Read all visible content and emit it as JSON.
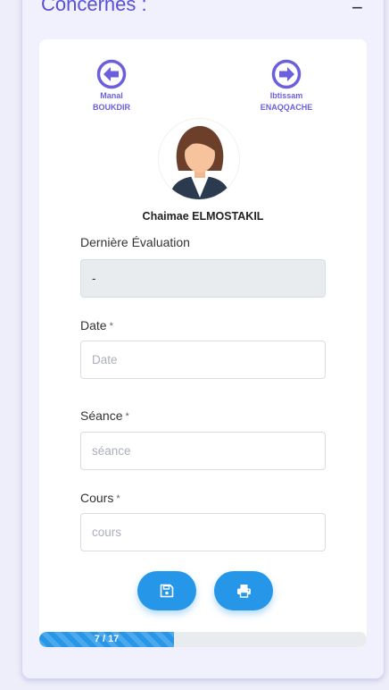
{
  "section": {
    "title": "Concernés :",
    "collapse_symbol": "−"
  },
  "navigation": {
    "previous": {
      "first_name": "Manal",
      "last_name": "BOUKDIR",
      "icon": "arrow-left-circle-icon"
    },
    "next": {
      "first_name": "Ibtissam",
      "last_name": "ENAQQACHE",
      "icon": "arrow-right-circle-icon"
    }
  },
  "student": {
    "name": "Chaimae ELMOSTAKIL",
    "avatar_icon": "female-avatar-icon"
  },
  "form": {
    "last_evaluation": {
      "label": "Dernière Évaluation",
      "value": "-"
    },
    "date": {
      "label": "Date",
      "required_mark": "*",
      "placeholder": "Date",
      "value": ""
    },
    "session": {
      "label": "Séance",
      "required_mark": "*",
      "placeholder": "séance",
      "value": ""
    },
    "course": {
      "label": "Cours",
      "required_mark": "*",
      "placeholder": "cours",
      "value": ""
    }
  },
  "actions": {
    "save_icon": "save-icon",
    "print_icon": "print-icon"
  },
  "progress": {
    "label": "7 / 17",
    "current": 7,
    "total": 17
  },
  "colors": {
    "accent": "#2596e8",
    "nav_purple": "#6b5fe0",
    "title_purple": "#5a4fd8"
  }
}
